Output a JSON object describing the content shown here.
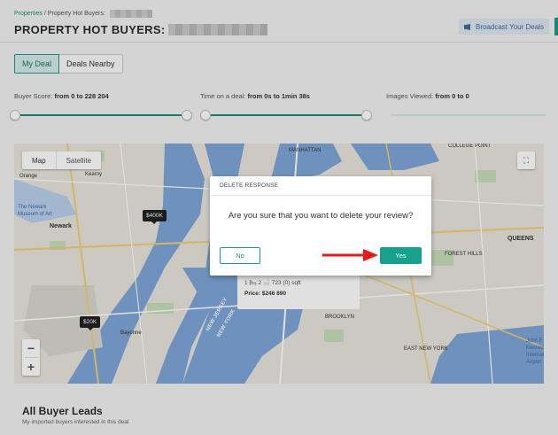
{
  "breadcrumb": {
    "link": "Properties",
    "separator": "/",
    "current": "Property Hot Buyers:"
  },
  "header": {
    "title": "PROPERTY HOT BUYERS:",
    "broadcast_label": "Broadcast Your Deals"
  },
  "tabs": [
    {
      "label": "My Deal",
      "active": true
    },
    {
      "label": "Deals Nearby",
      "active": false
    }
  ],
  "filters": [
    {
      "label": "Buyer Score:",
      "range": "from 0 to 228 204",
      "fill": 1.0
    },
    {
      "label": "Time on a deal:",
      "range": "from 0s to 1min 38s",
      "fill": 1.0
    },
    {
      "label": "Images Viewed:",
      "range": "from 0 to 0",
      "fill": 0.0
    }
  ],
  "map": {
    "type_toggle": {
      "map": "Map",
      "satellite": "Satellite"
    },
    "zoom_in": "+",
    "zoom_out": "−",
    "markers": [
      "$400K",
      "$20K"
    ],
    "labels": {
      "orange": "Orange",
      "kearny": "Kearny",
      "newark_museum": "The Newark\nMuseum of Art",
      "newark": "Newark",
      "bayonne": "Bayonne",
      "manhattan": "MANHATTAN",
      "queens": "QUEENS",
      "brooklyn": "BROOKLYN",
      "college_point": "COLLEGE POINT",
      "east_new_york": "EAST NEW YORK",
      "forest_hills": "FOREST HILLS",
      "jfk": "John F. Kennedy International Airport",
      "new_jersey": "NEW JERSEY",
      "new_york": "NEW YORK"
    },
    "info_card": {
      "specs": "1 🛏   2 🛁   723 (0) sqft",
      "price": "Price: $246 890"
    }
  },
  "modal": {
    "title": "DELETE RESPONSE",
    "message": "Are you sure that you want to delete your review?",
    "no_label": "No",
    "yes_label": "Yes"
  },
  "leads": {
    "title": "All Buyer Leads",
    "subtitle": "My imported buyers interested in this deal"
  },
  "colors": {
    "accent": "#17a08b",
    "arrow": "#e31b1b",
    "water": "#7ea7d8"
  }
}
